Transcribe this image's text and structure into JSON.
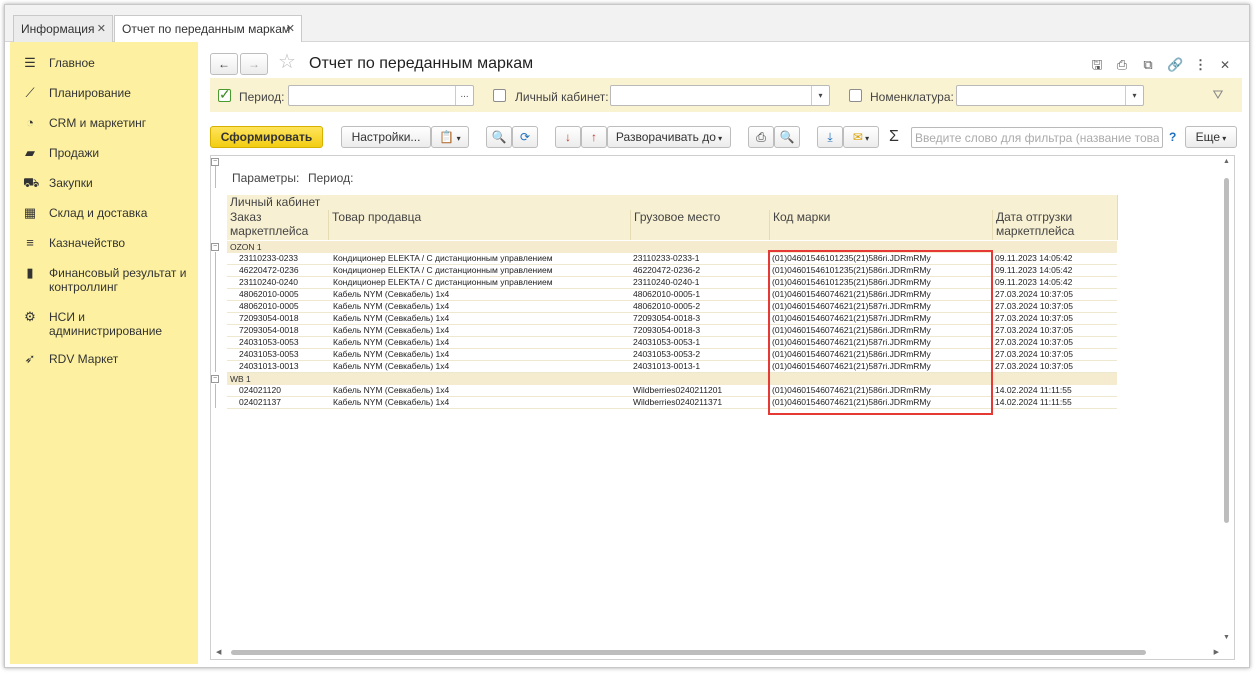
{
  "tabs": [
    {
      "label": "Информация"
    },
    {
      "label": "Отчет по переданным маркам"
    }
  ],
  "sidebar": {
    "items": [
      {
        "icon": "menu-icon",
        "label": "Главное"
      },
      {
        "icon": "chart-icon",
        "label": "Планирование"
      },
      {
        "icon": "pie-chart-icon",
        "label": "CRM и маркетинг"
      },
      {
        "icon": "bag-icon",
        "label": "Продажи"
      },
      {
        "icon": "cart-icon",
        "label": "Закупки"
      },
      {
        "icon": "warehouse-icon",
        "label": "Склад и доставка"
      },
      {
        "icon": "coins-icon",
        "label": "Казначейство"
      },
      {
        "icon": "bar-chart-icon",
        "label": "Финансовый результат и контроллинг"
      },
      {
        "icon": "gear-icon",
        "label": "НСИ и администрирование"
      },
      {
        "icon": "rocket-icon",
        "label": "RDV Маркет"
      }
    ]
  },
  "header": {
    "title": "Отчет по переданным маркам"
  },
  "filters": {
    "period": {
      "label": "Период:",
      "value": "",
      "checked": true
    },
    "cabinet": {
      "label": "Личный кабинет:",
      "value": "",
      "checked": false
    },
    "nomenclature": {
      "label": "Номенклатура:",
      "value": "",
      "checked": false
    }
  },
  "toolbar": {
    "generate": "Сформировать",
    "settings": "Настройки...",
    "expand": "Разворачивать до",
    "search_placeholder": "Введите слово для фильтра (название това...",
    "help": "?",
    "more": "Еще"
  },
  "report": {
    "params_label": "Параметры:",
    "period_label": "Период:",
    "group_header": "Личный кабинет",
    "columns": [
      "Заказ маркетплейса",
      "Товар продавца",
      "Грузовое место",
      "Код марки",
      "Дата отгрузки маркетплейса"
    ],
    "groups": [
      {
        "name": "OZON 1",
        "rows": [
          [
            "23110233-0233",
            "Кондиционер ELEKTA / С дистанционным управлением",
            "23110233-0233-1",
            "(01)04601546101235(21)586ri.JDRmRMy",
            "09.11.2023 14:05:42"
          ],
          [
            "46220472-0236",
            "Кондиционер ELEKTA / С дистанционным управлением",
            "46220472-0236-2",
            "(01)04601546101235(21)586ri.JDRmRMy",
            "09.11.2023 14:05:42"
          ],
          [
            "23110240-0240",
            "Кондиционер ELEKTA / С дистанционным управлением",
            "23110240-0240-1",
            "(01)04601546101235(21)586ri.JDRmRMy",
            "09.11.2023 14:05:42"
          ],
          [
            "48062010-0005",
            "Кабель NYM (Севкабель) 1х4",
            "48062010-0005-1",
            "(01)04601546074621(21)586ri.JDRmRMy",
            "27.03.2024 10:37:05"
          ],
          [
            "48062010-0005",
            "Кабель NYM (Севкабель) 1х4",
            "48062010-0005-2",
            "(01)04601546074621(21)587ri.JDRmRMy",
            "27.03.2024 10:37:05"
          ],
          [
            "72093054-0018",
            "Кабель NYM (Севкабель) 1х4",
            "72093054-0018-3",
            "(01)04601546074621(21)587ri.JDRmRMy",
            "27.03.2024 10:37:05"
          ],
          [
            "72093054-0018",
            "Кабель NYM (Севкабель) 1х4",
            "72093054-0018-3",
            "(01)04601546074621(21)586ri.JDRmRMy",
            "27.03.2024 10:37:05"
          ],
          [
            "24031053-0053",
            "Кабель NYM (Севкабель) 1х4",
            "24031053-0053-1",
            "(01)04601546074621(21)587ri.JDRmRMy",
            "27.03.2024 10:37:05"
          ],
          [
            "24031053-0053",
            "Кабель NYM (Севкабель) 1х4",
            "24031053-0053-2",
            "(01)04601546074621(21)586ri.JDRmRMy",
            "27.03.2024 10:37:05"
          ],
          [
            "24031013-0013",
            "Кабель NYM (Севкабель) 1х4",
            "24031013-0013-1",
            "(01)04601546074621(21)587ri.JDRmRMy",
            "27.03.2024 10:37:05"
          ]
        ]
      },
      {
        "name": "WB 1",
        "rows": [
          [
            "024021120",
            "Кабель NYM (Севкабель) 1х4",
            "Wildberries0240211201",
            "(01)04601546074621(21)586ri.JDRmRMy",
            "14.02.2024 11:11:55"
          ],
          [
            "024021137",
            "Кабель NYM (Севкабель) 1х4",
            "Wildberries0240211371",
            "(01)04601546074621(21)586ri.JDRmRMy",
            "14.02.2024 11:11:55"
          ]
        ]
      }
    ]
  },
  "colors": {
    "accent": "#f5d31d",
    "sidebar": "#fdf1a1",
    "highlight": "#e53935"
  }
}
